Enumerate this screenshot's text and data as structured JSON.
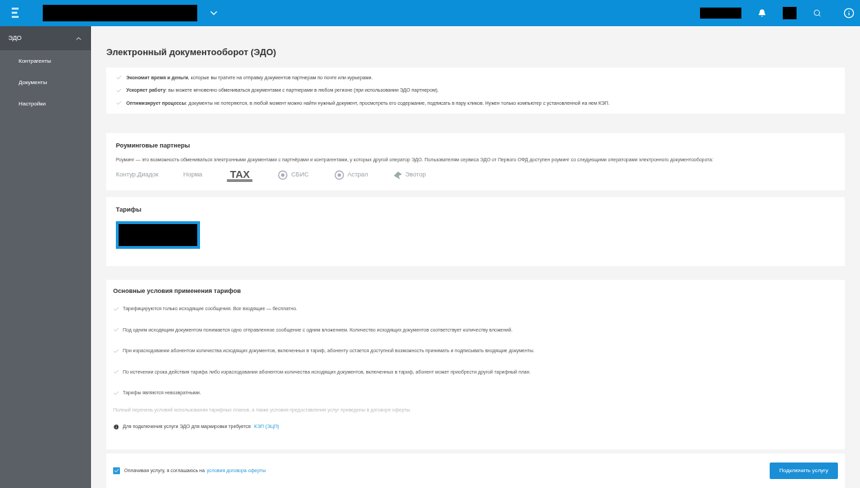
{
  "header": {
    "blocks": [
      {
        "kind": "wide"
      },
      {
        "kind": "caret"
      },
      {
        "kind": "spacer"
      },
      {
        "kind": "medium"
      },
      {
        "kind": "bell"
      },
      {
        "kind": "small"
      },
      {
        "kind": "search"
      },
      {
        "kind": "help"
      }
    ]
  },
  "sidebar": {
    "section": {
      "label": "ЭДО",
      "expanded": true
    },
    "items": [
      {
        "label": "Контрагенты",
        "selected": false
      },
      {
        "label": "Документы",
        "selected": false
      },
      {
        "label": "Настройки",
        "selected": false
      }
    ]
  },
  "page_title": "Электронный документооборот (ЭДО)",
  "benefits": [
    {
      "text": "**Экономит время и деньги**, которые вы тратите на отправку документов партнерам по почте или курьерами."
    },
    {
      "text": "**Ускоряет работу**: вы можете мгновенно обмениваться документами с партнерами в любом регионе (при использовании ЭДО партнером)."
    },
    {
      "text": "**Оптимизирует процессы**: документы не потеряются, в любой момент можно найти нужный документ, просмотреть его содержание, подписать в пару кликов. Нужен только компьютер с установленной на нем КЭП."
    }
  ],
  "roaming": {
    "title": "Роуминговые партнеры",
    "description": "Роуминг — это возможность обмениваться электронными документами с партнёрами и контрагентами, у которых другой оператор ЭДО. Пользователям сервиса ЭДО от Первого ОФД доступен роуминг со следующими операторами электронного документооборота:",
    "partners": [
      {
        "kind": "wordmark",
        "name": "Контур.Диадок"
      },
      {
        "kind": "wordmark",
        "name": "Норма"
      },
      {
        "kind": "tax",
        "name": "TAX"
      },
      {
        "kind": "emblem",
        "name": "СБИС"
      },
      {
        "kind": "emblem",
        "name": "Астрал"
      },
      {
        "kind": "bird",
        "name": "Эвотор"
      }
    ]
  },
  "tariffs": {
    "title": "Тарифы"
  },
  "conditions": {
    "title": "Основные условия применения тарифов",
    "items": [
      "Тарифицируются только исходящие сообщения. Все входящие — бесплатно.",
      "Под одним исходящим документом понимается одно отправленное сообщение с одним вложением. Количество исходящих документов соответствует количеству вложений.",
      "При израсходовании абонентом количества исходящих документов, включенных в тариф, абоненту остается доступной возможность принимать и подписывать входящие документы.",
      "По истечении срока действия тарифа либо израсходовании абонентом количества исходящих документов, включенных в тариф, абонент может приобрести другой тарифный план.",
      "Тарифы являются невозвратными."
    ],
    "note": "Полный перечень условий использования тарифных планов, а также условия предоставления услуг приведены в договоре оферты.",
    "info": {
      "text": "Для подключения услуги ЭДО для маркировки требуется",
      "link": "КЭП (ЭЦП)"
    }
  },
  "footer": {
    "agree": {
      "checked": true,
      "text": "Оплачивая услугу, я соглашаюсь на",
      "link": "условия договора оферты"
    },
    "button": "Подключить услугу"
  }
}
